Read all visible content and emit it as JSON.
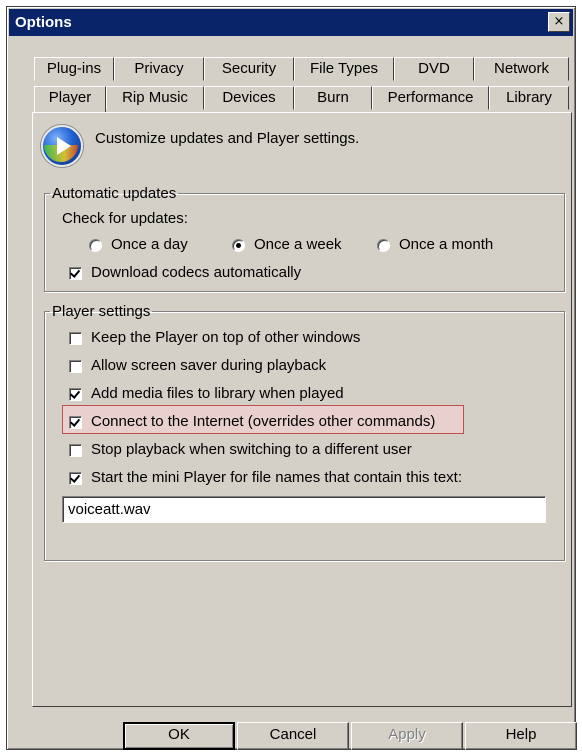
{
  "window": {
    "title": "Options",
    "close_glyph": "×",
    "close_icon": "close-icon"
  },
  "tabs": {
    "row_top": [
      "Plug-ins",
      "Privacy",
      "Security",
      "File Types",
      "DVD",
      "Network"
    ],
    "row_bottom": [
      "Player",
      "Rip Music",
      "Devices",
      "Burn",
      "Performance",
      "Library"
    ],
    "active": "Player"
  },
  "header": {
    "icon": "windows-media-player-icon",
    "text": "Customize updates and Player settings."
  },
  "automatic_updates": {
    "legend": "Automatic updates",
    "check_label": "Check for updates:",
    "options": [
      {
        "label": "Once a day",
        "selected": false
      },
      {
        "label": "Once a week",
        "selected": true
      },
      {
        "label": "Once a month",
        "selected": false
      }
    ],
    "download_codecs": {
      "label": "Download codecs automatically",
      "checked": true
    }
  },
  "player_settings": {
    "legend": "Player settings",
    "options": [
      {
        "label": "Keep the Player on top of other windows",
        "checked": false
      },
      {
        "label": "Allow screen saver during playback",
        "checked": false
      },
      {
        "label": "Add media files to library when played",
        "checked": true
      },
      {
        "label": "Connect to the Internet (overrides other commands)",
        "checked": true
      },
      {
        "label": "Stop playback when switching to a different user",
        "checked": false
      },
      {
        "label": "Start the mini Player for file names that contain this text:",
        "checked": true
      }
    ],
    "mini_player_text": "voiceatt.wav"
  },
  "buttons": {
    "ok": "OK",
    "cancel": "Cancel",
    "apply": "Apply",
    "help": "Help"
  },
  "colors": {
    "face": "#d4d0c8",
    "titlebar": "#0a246a",
    "highlight_border": "#c0504d",
    "highlight_fill": "#e8d0cf"
  }
}
